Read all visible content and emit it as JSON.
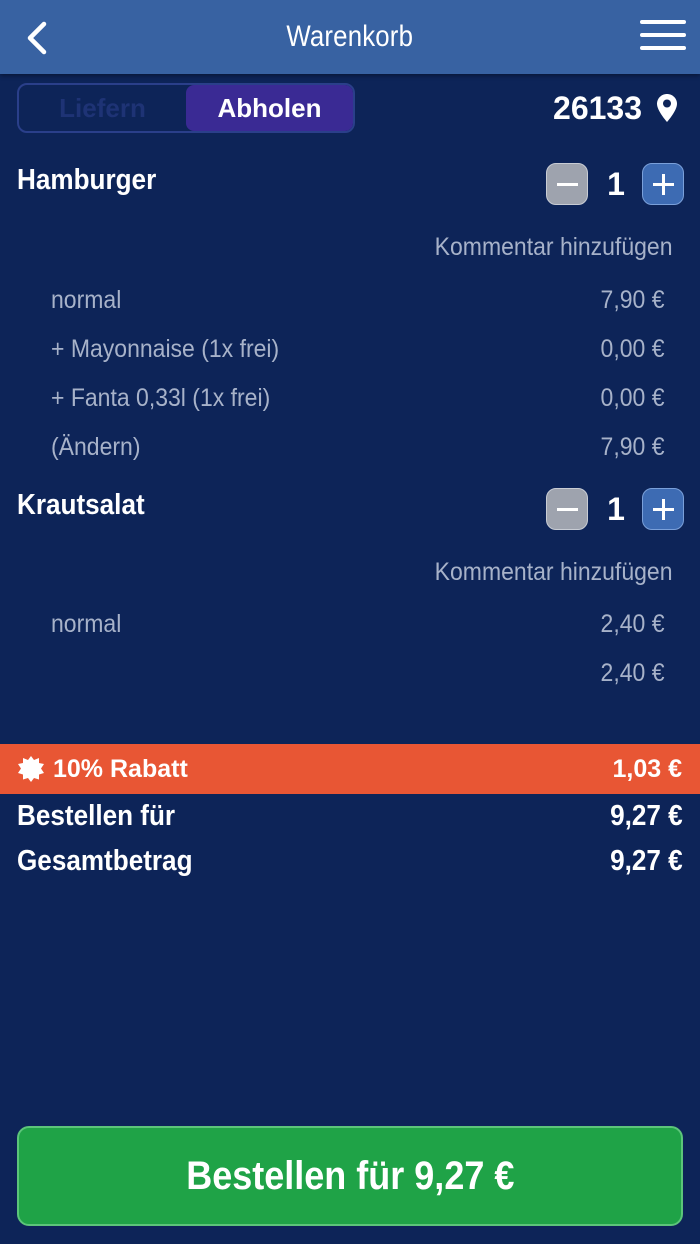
{
  "header": {
    "title": "Warenkorb"
  },
  "mode_toggle": {
    "options": [
      "Liefern",
      "Abholen"
    ],
    "selected": "Abholen"
  },
  "location": {
    "zip": "26133"
  },
  "items": [
    {
      "name": "Hamburger",
      "quantity": "1",
      "comment_link": "Kommentar hinzufügen",
      "lines": [
        {
          "label": "normal",
          "price": "7,90 €"
        },
        {
          "label": "+ Mayonnaise (1x frei)",
          "price": "0,00 €"
        },
        {
          "label": "+ Fanta 0,33l (1x frei)",
          "price": "0,00 €"
        },
        {
          "label": "(Ändern)",
          "price": "7,90 €"
        }
      ]
    },
    {
      "name": "Krautsalat",
      "quantity": "1",
      "comment_link": "Kommentar hinzufügen",
      "lines": [
        {
          "label": "normal",
          "price": "2,40 €"
        },
        {
          "label": "",
          "price": "2,40 €"
        }
      ]
    }
  ],
  "discount": {
    "label": "10% Rabatt",
    "amount": "1,03 €",
    "color": "#e85634"
  },
  "totals": {
    "order_for_label": "Bestellen für",
    "order_for_value": "9,27 €",
    "total_label": "Gesamtbetrag",
    "total_value": "9,27 €"
  },
  "order_button": {
    "label": "Bestellen für 9,27 €",
    "color": "#1fa347"
  },
  "colors": {
    "background": "#0d2458",
    "header": "#3862a2",
    "toggle_active": "#3a2a94"
  },
  "icons": [
    "back-chevron-icon",
    "hamburger-menu-icon",
    "location-pin-icon",
    "minus-icon",
    "plus-icon",
    "badge-icon"
  ]
}
